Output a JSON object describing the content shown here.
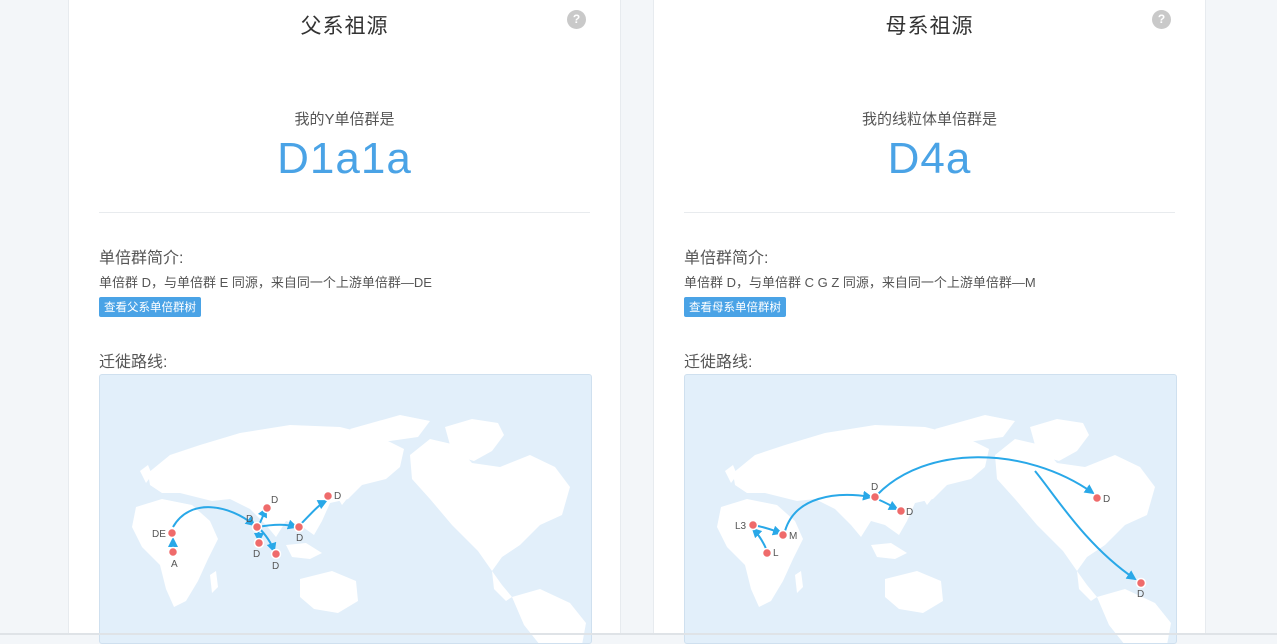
{
  "paternal": {
    "title": "父系祖源",
    "help": "?",
    "haplogroup_label": "我的Y单倍群是",
    "haplogroup_value": "D1a1a",
    "intro_heading": "单倍群简介:",
    "intro_text": "单倍群 D，与单倍群 E 同源，来自同一个上游单倍群—DE",
    "tree_button": "查看父系单倍群树",
    "route_heading": "迁徙路线:",
    "map_labels": [
      "DE",
      "A",
      "D",
      "D",
      "D",
      "D",
      "D",
      "D"
    ]
  },
  "maternal": {
    "title": "母系祖源",
    "help": "?",
    "haplogroup_label": "我的线粒体单倍群是",
    "haplogroup_value": "D4a",
    "intro_heading": "单倍群简介:",
    "intro_text": "单倍群 D，与单倍群 C G Z 同源，来自同一个上游单倍群—M",
    "tree_button": "查看母系单倍群树",
    "route_heading": "迁徙路线:",
    "map_labels": [
      "L3",
      "L",
      "M",
      "D",
      "D",
      "D",
      "D"
    ]
  },
  "colors": {
    "accent": "#4aa3e6",
    "route": "#29a8e8",
    "marker": "#ef6b6b",
    "land": "#ffffff",
    "sea": "#e2effa"
  }
}
